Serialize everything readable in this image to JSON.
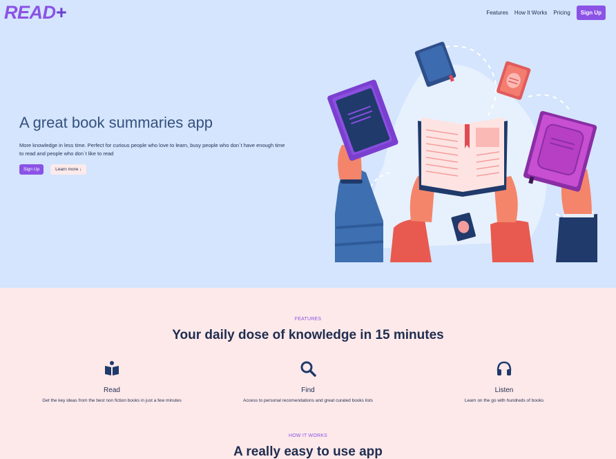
{
  "header": {
    "logo_main": "READ",
    "logo_plus": "+",
    "nav": [
      "Features",
      "How It Works",
      "Pricing"
    ],
    "signup_label": "Sign Up"
  },
  "hero": {
    "title": "A great book summaries app",
    "description": "More knowledge in less time. Perfect for curious people who love to learn, busy people who don´t have enough time to read and people who don´t like to read",
    "primary_button": "Sign Up",
    "secondary_button": "Learn more ↓"
  },
  "features": {
    "label": "FEATURES",
    "title": "Your daily dose of knowledge in 15 minutes",
    "items": [
      {
        "icon": "book-icon",
        "name": "Read",
        "desc": "Get the key ideas from the best non fiction books in just a few minutes"
      },
      {
        "icon": "search-icon",
        "name": "Find",
        "desc": "Access to personal recomendations and great curated books lists"
      },
      {
        "icon": "headphones-icon",
        "name": "Listen",
        "desc": "Learn on the go with hundreds of books"
      }
    ]
  },
  "how_it_works": {
    "label": "HOW IT WORKS",
    "title": "A really easy to use app"
  },
  "colors": {
    "accent": "#8b52e6",
    "hero_bg": "#d4e5fd",
    "features_bg": "#fde9ea",
    "text": "#1f2d4f"
  }
}
